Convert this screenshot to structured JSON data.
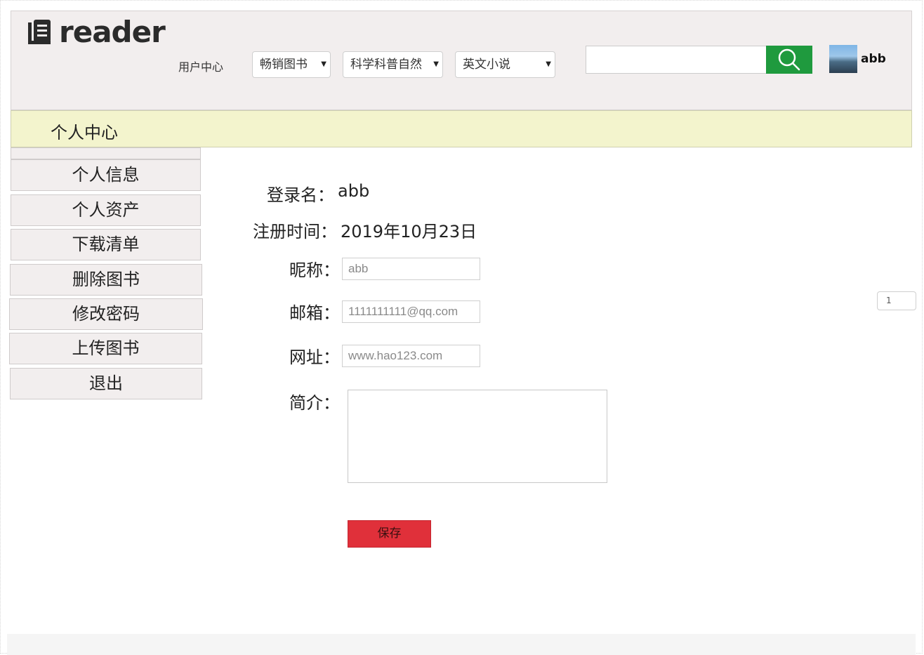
{
  "header": {
    "logo_text": "reader",
    "nav_user_center": "用户中心",
    "dropdowns": [
      {
        "label": "畅销图书"
      },
      {
        "label": "科学科普自然"
      },
      {
        "label": "英文小说"
      }
    ],
    "search": {
      "value": "",
      "placeholder": ""
    },
    "user": {
      "name": "abb"
    }
  },
  "section_bar": {
    "title": "个人中心"
  },
  "sidebar": {
    "items": [
      {
        "label": "个人信息"
      },
      {
        "label": "个人资产"
      },
      {
        "label": "下载清单"
      },
      {
        "label": "删除图书"
      },
      {
        "label": "修改密码"
      },
      {
        "label": "上传图书"
      },
      {
        "label": "退出"
      }
    ]
  },
  "profile": {
    "login_label": "登录名：",
    "login_value": "abb",
    "reg_label": "注册时间：",
    "reg_value": "2019年10月23日",
    "nickname_label": "昵称：",
    "nickname_value": "abb",
    "email_label": "邮箱：",
    "email_value": "1111111111@qq.com",
    "website_label": "网址：",
    "website_value": "www.hao123.com",
    "intro_label": "简介：",
    "intro_value": "",
    "save_label": "保存"
  },
  "pager": {
    "value": "1"
  },
  "colors": {
    "header_bg": "#f2eeee",
    "bar_bg": "#f3f4cd",
    "search_btn": "#1f9a3e",
    "save_btn": "#e0303a"
  },
  "icons": {
    "logo": "book-icon",
    "search": "search-icon",
    "dropdown": "caret-down-icon"
  }
}
